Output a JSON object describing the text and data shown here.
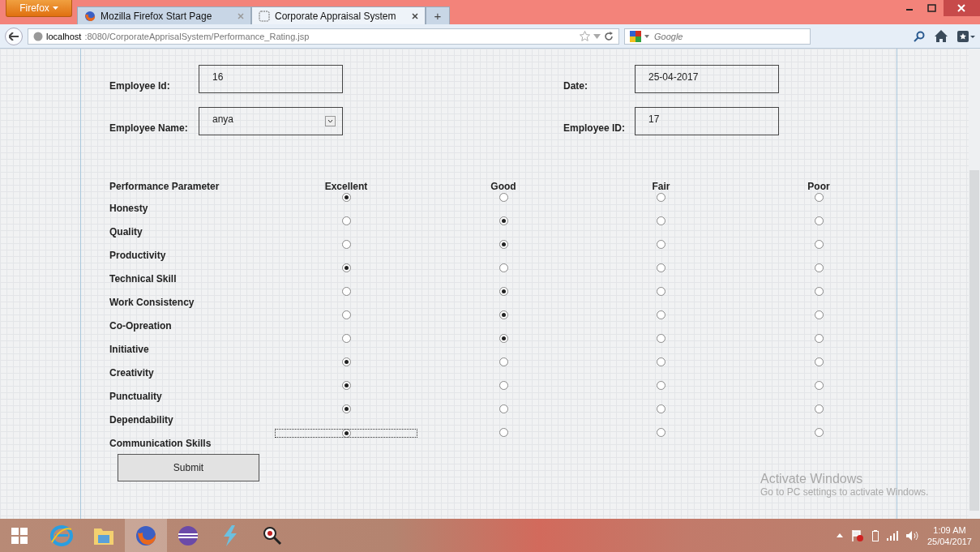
{
  "browser": {
    "menu_label": "Firefox",
    "tabs": [
      {
        "title": "Mozilla Firefox Start Page",
        "selected": false
      },
      {
        "title": "Corporate Appraisal System",
        "selected": true
      }
    ],
    "new_tab": "+",
    "url_host": "localhost",
    "url_rest": ":8080/CorporateApprisalSystem/Performance_Rating.jsp",
    "search": {
      "placeholder": "Google"
    }
  },
  "form": {
    "fields": [
      {
        "label": "Employee Id:",
        "value": "16",
        "kind": "text"
      },
      {
        "label": "Date:",
        "value": "25-04-2017",
        "kind": "text"
      },
      {
        "label": "Employee Name:",
        "value": "anya",
        "kind": "select"
      },
      {
        "label": "Employee ID:",
        "value": "17",
        "kind": "text"
      }
    ],
    "columns": [
      "Performance Parameter",
      "Excellent",
      "Good",
      "Fair",
      "Poor"
    ],
    "rows": [
      {
        "parameter": "Honesty",
        "focused": false,
        "options": [
          {
            "selected": true
          },
          {
            "selected": false
          },
          {
            "selected": false
          },
          {
            "selected": false
          }
        ]
      },
      {
        "parameter": "Quality",
        "focused": false,
        "options": [
          {
            "selected": false
          },
          {
            "selected": true
          },
          {
            "selected": false
          },
          {
            "selected": false
          }
        ]
      },
      {
        "parameter": "Productivity",
        "focused": false,
        "options": [
          {
            "selected": false
          },
          {
            "selected": true
          },
          {
            "selected": false
          },
          {
            "selected": false
          }
        ]
      },
      {
        "parameter": "Technical Skill",
        "focused": false,
        "options": [
          {
            "selected": true
          },
          {
            "selected": false
          },
          {
            "selected": false
          },
          {
            "selected": false
          }
        ]
      },
      {
        "parameter": "Work Consistency",
        "focused": false,
        "options": [
          {
            "selected": false
          },
          {
            "selected": true
          },
          {
            "selected": false
          },
          {
            "selected": false
          }
        ]
      },
      {
        "parameter": "Co-Opreation",
        "focused": false,
        "options": [
          {
            "selected": false
          },
          {
            "selected": true
          },
          {
            "selected": false
          },
          {
            "selected": false
          }
        ]
      },
      {
        "parameter": "Initiative",
        "focused": false,
        "options": [
          {
            "selected": false
          },
          {
            "selected": true
          },
          {
            "selected": false
          },
          {
            "selected": false
          }
        ]
      },
      {
        "parameter": "Creativity",
        "focused": false,
        "options": [
          {
            "selected": true
          },
          {
            "selected": false
          },
          {
            "selected": false
          },
          {
            "selected": false
          }
        ]
      },
      {
        "parameter": "Punctuality",
        "focused": false,
        "options": [
          {
            "selected": true
          },
          {
            "selected": false
          },
          {
            "selected": false
          },
          {
            "selected": false
          }
        ]
      },
      {
        "parameter": "Dependability",
        "focused": false,
        "options": [
          {
            "selected": true
          },
          {
            "selected": false
          },
          {
            "selected": false
          },
          {
            "selected": false
          }
        ]
      },
      {
        "parameter": "Communication Skills",
        "focused": true,
        "options": [
          {
            "selected": true
          },
          {
            "selected": false
          },
          {
            "selected": false
          },
          {
            "selected": false
          }
        ]
      }
    ],
    "submit": "Submit"
  },
  "activation": {
    "title": "Activate Windows",
    "message": "Go to PC settings to activate Windows."
  },
  "taskbar": {
    "apps": [
      {
        "kind": "ie",
        "selected": false
      },
      {
        "kind": "folder",
        "selected": false
      },
      {
        "kind": "firefox",
        "selected": true
      },
      {
        "kind": "eclipse",
        "selected": false
      },
      {
        "kind": "bolt",
        "selected": false
      },
      {
        "kind": "magnifier",
        "selected": false
      }
    ],
    "time": "1:09 AM",
    "date": "25/04/2017"
  }
}
